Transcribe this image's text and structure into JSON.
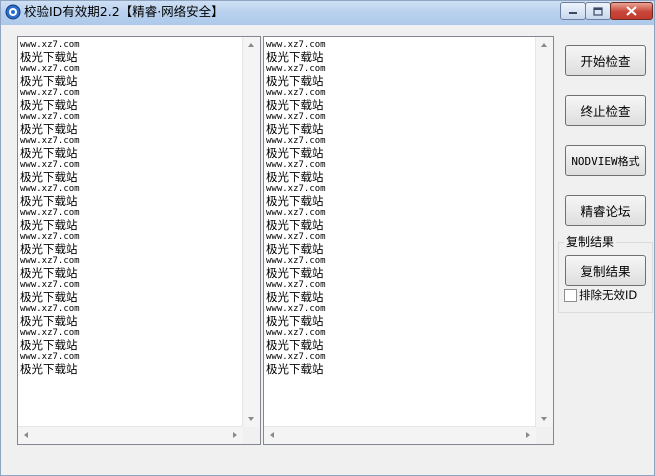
{
  "window": {
    "title": "校验ID有效期2.2【精睿·网络安全】",
    "minimize_label": "—",
    "maximize_label": "□",
    "close_label": "✕"
  },
  "lists": {
    "left": {
      "rows": [
        {
          "url": "www.xz7.com",
          "caption": "极光下载站"
        },
        {
          "url": "www.xz7.com",
          "caption": "极光下载站"
        },
        {
          "url": "www.xz7.com",
          "caption": "极光下载站"
        },
        {
          "url": "www.xz7.com",
          "caption": "极光下载站"
        },
        {
          "url": "www.xz7.com",
          "caption": "极光下载站"
        },
        {
          "url": "www.xz7.com",
          "caption": "极光下载站"
        },
        {
          "url": "www.xz7.com",
          "caption": "极光下载站"
        },
        {
          "url": "www.xz7.com",
          "caption": "极光下载站"
        },
        {
          "url": "www.xz7.com",
          "caption": "极光下载站"
        },
        {
          "url": "www.xz7.com",
          "caption": "极光下载站"
        },
        {
          "url": "www.xz7.com",
          "caption": "极光下载站"
        },
        {
          "url": "www.xz7.com",
          "caption": "极光下载站"
        },
        {
          "url": "www.xz7.com",
          "caption": "极光下载站"
        },
        {
          "url": "www.xz7.com",
          "caption": "极光下载站"
        }
      ]
    },
    "right": {
      "rows": [
        {
          "url": "www.xz7.com",
          "caption": "极光下载站"
        },
        {
          "url": "www.xz7.com",
          "caption": "极光下载站"
        },
        {
          "url": "www.xz7.com",
          "caption": "极光下载站"
        },
        {
          "url": "www.xz7.com",
          "caption": "极光下载站"
        },
        {
          "url": "www.xz7.com",
          "caption": "极光下载站"
        },
        {
          "url": "www.xz7.com",
          "caption": "极光下载站"
        },
        {
          "url": "www.xz7.com",
          "caption": "极光下载站"
        },
        {
          "url": "www.xz7.com",
          "caption": "极光下载站"
        },
        {
          "url": "www.xz7.com",
          "caption": "极光下载站"
        },
        {
          "url": "www.xz7.com",
          "caption": "极光下载站"
        },
        {
          "url": "www.xz7.com",
          "caption": "极光下载站"
        },
        {
          "url": "www.xz7.com",
          "caption": "极光下载站"
        },
        {
          "url": "www.xz7.com",
          "caption": "极光下载站"
        },
        {
          "url": "www.xz7.com",
          "caption": "极光下载站"
        }
      ]
    }
  },
  "buttons": {
    "start_check": "开始检查",
    "stop_check": "终止检查",
    "nodview_format": "NODVIEW格式",
    "forum": "精睿论坛",
    "copy_result": "复制结果"
  },
  "copy_group": {
    "title": "复制结果",
    "exclude_invalid_label": "排除无效ID",
    "exclude_invalid_checked": false
  },
  "icons": {
    "app": "app-icon",
    "scroll_up": "scroll-up-arrow-icon",
    "scroll_down": "scroll-down-arrow-icon",
    "scroll_left": "scroll-left-arrow-icon",
    "scroll_right": "scroll-right-arrow-icon"
  },
  "colors": {
    "titlebar": "#b9d1ee",
    "close_button": "#c8453a",
    "window_bg": "#f0f0f0"
  }
}
